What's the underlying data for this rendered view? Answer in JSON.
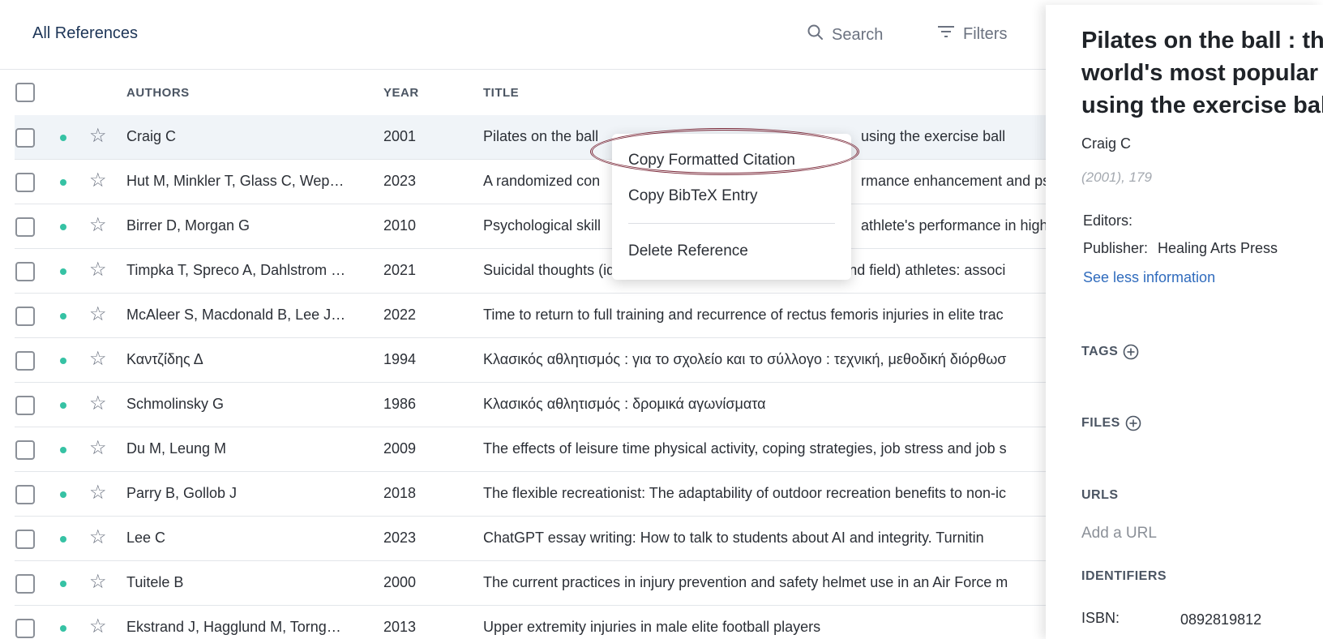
{
  "toolbar": {
    "collection_label": "All References",
    "search_label": "Search",
    "filters_label": "Filters"
  },
  "columns": {
    "authors": "AUTHORS",
    "year": "YEAR",
    "title": "TITLE"
  },
  "rows": [
    {
      "authors": "Craig C",
      "year": "2001",
      "title": "Pilates on the ball",
      "title_tail": "using the exercise ball",
      "selected": true
    },
    {
      "authors": "Hut M, Minkler T, Glass C, Wep…",
      "year": "2023",
      "title": "A randomized con",
      "title_tail": "rmance enhancement and ps"
    },
    {
      "authors": "Birrer D, Morgan G",
      "year": "2010",
      "title": "Psychological skill",
      "title_tail": "athlete's performance in high"
    },
    {
      "authors": "Timpka T, Spreco A, Dahlstrom …",
      "year": "2021",
      "title": "Suicidal thoughts (ideation) among elite athletics (track and field) athletes: associ"
    },
    {
      "authors": "McAleer S, Macdonald B, Lee J…",
      "year": "2022",
      "title": "Time to return to full training and recurrence of rectus femoris injuries in elite trac"
    },
    {
      "authors": "Καντζίδης Δ",
      "year": "1994",
      "title": "Κλασικός αθλητισμός : για το σχολείο και το σύλλογο : τεχνική, μεθοδική διόρθωσ"
    },
    {
      "authors": "Schmolinsky G",
      "year": "1986",
      "title": "Κλασικός αθλητισμός : δρομικά αγωνίσματα"
    },
    {
      "authors": "Du M, Leung M",
      "year": "2009",
      "title": "The effects of leisure time physical activity, coping strategies, job stress and job s"
    },
    {
      "authors": "Parry B, Gollob J",
      "year": "2018",
      "title": "The flexible recreationist: The adaptability of outdoor recreation benefits to non-ic"
    },
    {
      "authors": "Lee C",
      "year": "2023",
      "title": "ChatGPT essay writing: How to talk to students about AI and integrity. Turnitin"
    },
    {
      "authors": "Tuitele B",
      "year": "2000",
      "title": "The current practices in injury prevention and safety helmet use in an Air Force m"
    },
    {
      "authors": "Ekstrand J, Hagglund M, Torng…",
      "year": "2013",
      "title": "Upper extremity injuries in male elite football players"
    }
  ],
  "context_menu": {
    "copy_citation": "Copy Formatted Citation",
    "copy_bibtex": "Copy BibTeX Entry",
    "delete": "Delete Reference"
  },
  "detail": {
    "title": "Pilates on the ball : the world's most popular workout using the exercise ball",
    "authors": "Craig C",
    "year_pages": "(2001), 179",
    "editors_label": "Editors:",
    "publisher_label": "Publisher:",
    "publisher_value": "Healing Arts Press",
    "see_less": "See less information",
    "tags_label": "TAGS",
    "files_label": "FILES",
    "urls_label": "URLS",
    "add_url": "Add a URL",
    "identifiers_label": "IDENTIFIERS",
    "isbn_label": "ISBN:",
    "isbn_value": "0892819812"
  },
  "colors": {
    "accent_link": "#2f6bbd",
    "status_dot": "#36c2a4",
    "highlight_oval": "#7a2838"
  }
}
